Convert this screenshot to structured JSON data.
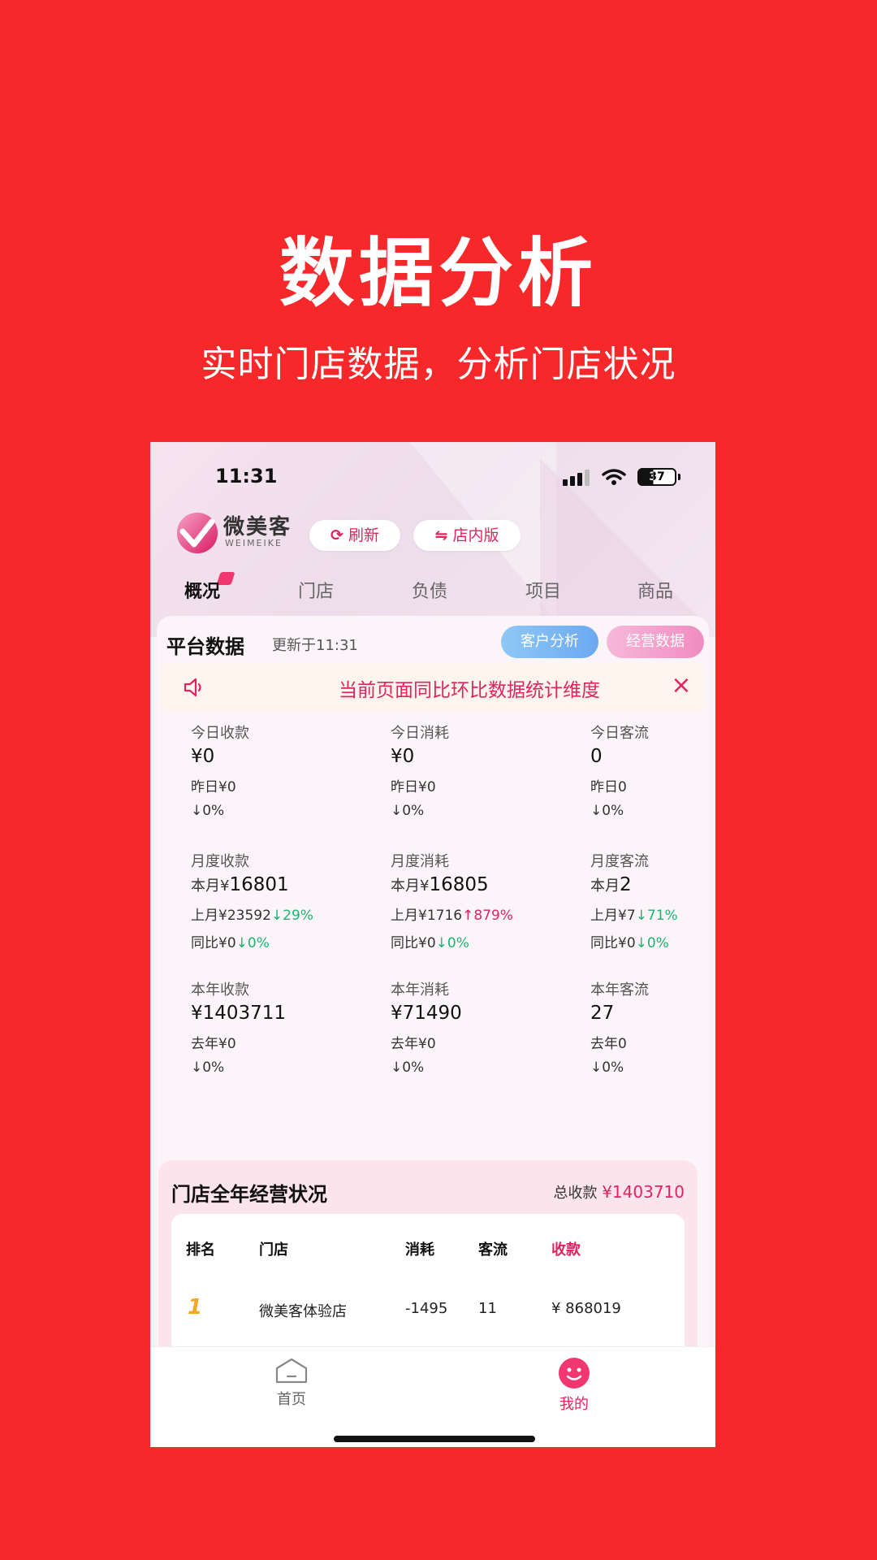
{
  "promo": {
    "title": "数据分析",
    "subtitle": "实时门店数据，分析门店状况"
  },
  "status_bar": {
    "time": "11:31",
    "battery": "37"
  },
  "header": {
    "logo_text": "微美客",
    "logo_sub": "WEIMEIKE",
    "refresh_label": "刷新",
    "store_label": "店内版"
  },
  "tabs": [
    "概况",
    "门店",
    "负债",
    "项目",
    "商品"
  ],
  "platform": {
    "title": "平台数据",
    "updated": "更新于11:31",
    "customer_btn": "客户分析",
    "business_btn": "经营数据",
    "notice": "当前页面同比环比数据统计维度"
  },
  "stats": {
    "today_income": {
      "label": "今日收款",
      "value": "¥0",
      "prev": "昨日¥0",
      "change": "↓0%"
    },
    "today_consume": {
      "label": "今日消耗",
      "value": "¥0",
      "prev": "昨日¥0",
      "change": "↓0%"
    },
    "today_traffic": {
      "label": "今日客流",
      "value": "0",
      "prev": "昨日0",
      "change": "↓0%"
    },
    "month_income": {
      "label": "月度收款",
      "value_prefix": "本月¥",
      "value": "16801",
      "last_prefix": "上月¥23592",
      "last_change": "↓29%",
      "yoy_prefix": "同比¥0",
      "yoy_change": "↓0%"
    },
    "month_consume": {
      "label": "月度消耗",
      "value_prefix": "本月¥",
      "value": "16805",
      "last_prefix": "上月¥1716",
      "last_change": "↑879%",
      "yoy_prefix": "同比¥0",
      "yoy_change": "↓0%"
    },
    "month_traffic": {
      "label": "月度客流",
      "value_prefix": "本月",
      "value": "2",
      "last_prefix": "上月¥7",
      "last_change": "↓71%",
      "yoy_prefix": "同比¥0",
      "yoy_change": "↓0%"
    },
    "year_income": {
      "label": "本年收款",
      "value": "¥1403711",
      "prev": "去年¥0",
      "change": "↓0%"
    },
    "year_consume": {
      "label": "本年消耗",
      "value": "¥71490",
      "prev": "去年¥0",
      "change": "↓0%"
    },
    "year_traffic": {
      "label": "本年客流",
      "value": "27",
      "prev": "去年0",
      "change": "↓0%"
    }
  },
  "store_status": {
    "title": "门店全年经营状况",
    "total_label": "总收款",
    "total_value": "¥1403710",
    "columns": [
      "排名",
      "门店",
      "消耗",
      "客流",
      "收款"
    ],
    "rows": [
      {
        "rank": "1",
        "store": "微美客体验店",
        "consume": "-1495",
        "traffic": "11",
        "income": "¥ 868019"
      }
    ]
  },
  "bottom_nav": {
    "home": "首页",
    "mine": "我的"
  },
  "colors": {
    "brand_red": "#F7282A",
    "accent_pink": "#E0245E",
    "down_green": "#1DB36F",
    "rank_gold": "#F5A623"
  }
}
